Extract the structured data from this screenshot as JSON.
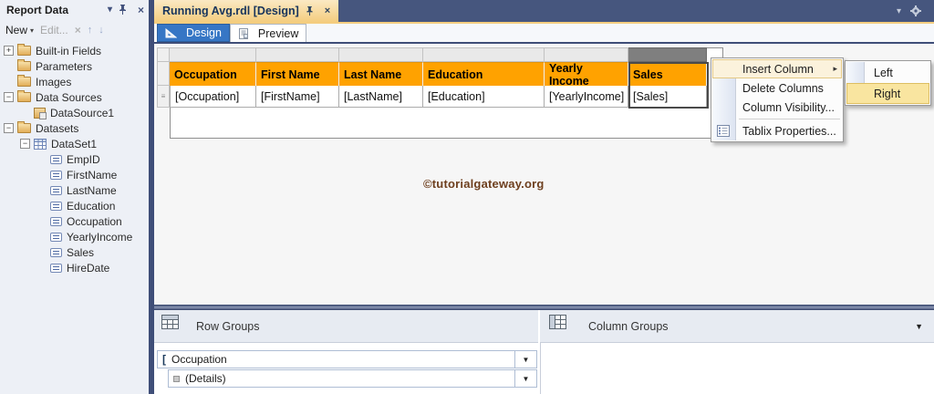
{
  "icons": {
    "chevron_down": "▾",
    "close": "×",
    "dropdown_caret": "▼",
    "submenu_arrow": "▸",
    "up_arrow": "↑",
    "down_arrow": "↓",
    "details_handle": "≡",
    "group_bracket": "[",
    "expander_collapsed": "+",
    "expander_expanded": "−"
  },
  "sidebar": {
    "title": "Report Data",
    "toolbar": {
      "new_label": "New",
      "edit_label": "Edit..."
    },
    "tree": [
      {
        "label": "Built-in Fields",
        "expander": "+"
      },
      {
        "label": "Parameters"
      },
      {
        "label": "Images"
      },
      {
        "label": "Data Sources",
        "expander": "−"
      },
      {
        "label": "DataSource1"
      },
      {
        "label": "Datasets",
        "expander": "−"
      },
      {
        "label": "DataSet1",
        "expander": "−"
      },
      {
        "label": "EmpID"
      },
      {
        "label": "FirstName"
      },
      {
        "label": "LastName"
      },
      {
        "label": "Education"
      },
      {
        "label": "Occupation"
      },
      {
        "label": "YearlyIncome"
      },
      {
        "label": "Sales"
      },
      {
        "label": "HireDate"
      }
    ]
  },
  "document": {
    "tab_title": "Running Avg.rdl [Design]",
    "views": [
      {
        "label": "Design"
      },
      {
        "label": "Preview"
      }
    ]
  },
  "designer": {
    "columns": [
      "Occupation",
      "First Name",
      "Last Name",
      "Education",
      "Yearly Income",
      "Sales"
    ],
    "data_row": [
      "[Occupation]",
      "[FirstName]",
      "[LastName]",
      "[Education]",
      "[YearlyIncome]",
      "[Sales]"
    ],
    "watermark": "©tutorialgateway.org"
  },
  "context_menu": {
    "items": [
      {
        "label": "Insert Column",
        "has_submenu": true,
        "highlighted": true
      },
      {
        "label": "Delete Columns"
      },
      {
        "label": "Column Visibility..."
      },
      {
        "label": "Tablix Properties..."
      }
    ],
    "submenu": [
      {
        "label": "Left"
      },
      {
        "label": "Right",
        "highlighted": true
      }
    ]
  },
  "grouping": {
    "row_groups_label": "Row Groups",
    "column_groups_label": "Column Groups",
    "row_groups": [
      {
        "label": "Occupation"
      },
      {
        "label": "(Details)"
      }
    ]
  },
  "colors": {
    "table_header_orange": "#FFA200",
    "active_tab_yellow": "#F4CD7F",
    "splitter_navy": "#3F4E78",
    "tabstrip_blue": "#46567E",
    "design_button_blue": "#3676C5",
    "menu_highlight_cream": "#FBF2DC",
    "submenu_highlight_yellow": "#F9E5A0",
    "selected_handle_gray": "#7F7F7F",
    "watermark_brown": "#6E3F1E"
  }
}
